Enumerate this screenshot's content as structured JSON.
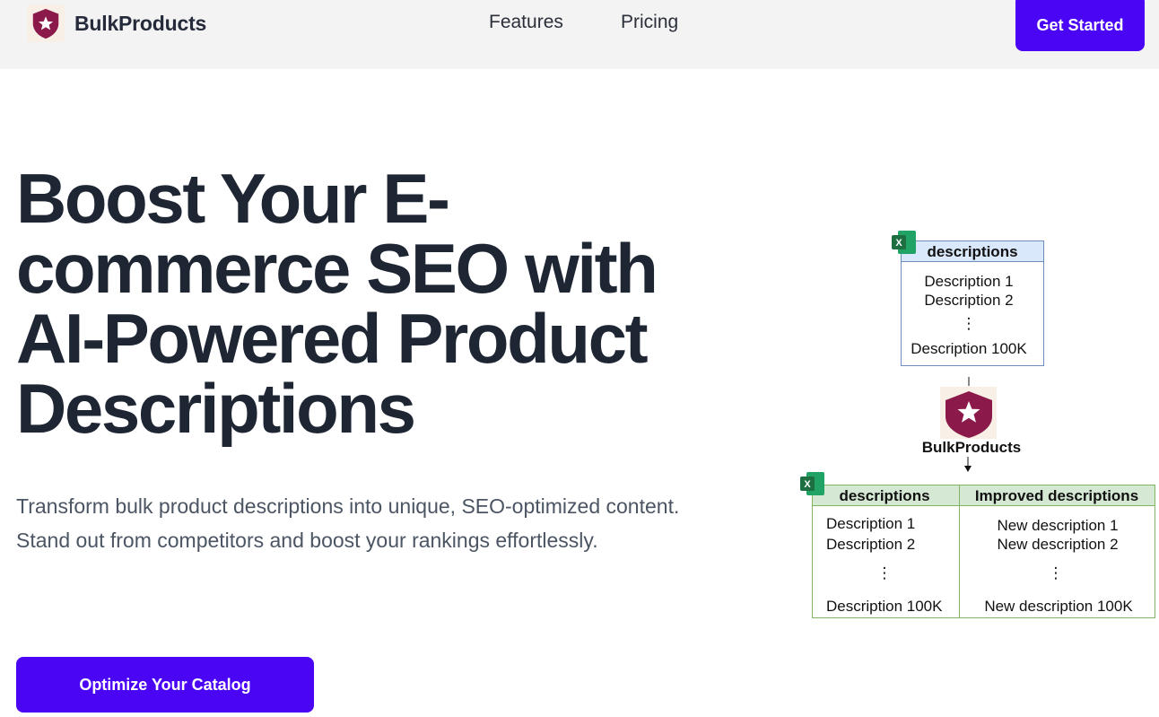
{
  "header": {
    "brand_name": "BulkProducts",
    "nav": [
      {
        "label": "Features"
      },
      {
        "label": "Pricing"
      }
    ],
    "cta_label": "Get Started"
  },
  "hero": {
    "headline": "Boost Your E-commerce SEO with AI-Powered Product Descriptions",
    "subtitle": "Transform bulk product descriptions into unique, SEO-optimized content. Stand out from competitors and boost your rankings effortlessly.",
    "cta_label": "Optimize Your Catalog"
  },
  "diagram": {
    "input_sheet": {
      "icon_letter": "X",
      "header": "descriptions",
      "rows": [
        "Description 1",
        "Description 2",
        "⋮",
        "Description 100K"
      ]
    },
    "processor_label": "BulkProducts",
    "output_sheet": {
      "icon_letter": "X",
      "headers": [
        "descriptions",
        "Improved descriptions"
      ],
      "left_rows": [
        "Description 1",
        "Description 2",
        "⋮",
        "Description 100K"
      ],
      "right_rows": [
        "New description 1",
        "New description 2",
        "⋮",
        "New description 100K"
      ]
    }
  },
  "colors": {
    "accent": "#4a05f5",
    "logo_shield": "#8b1a4a",
    "input_header_fill": "#dae8fc",
    "input_border": "#6c8ebf",
    "output_header_fill": "#d5e8d4",
    "output_border": "#82b366",
    "excel_green": "#1d6f42"
  },
  "icons": {
    "brand": "shield-star-logo",
    "spreadsheet": "excel-icon"
  }
}
